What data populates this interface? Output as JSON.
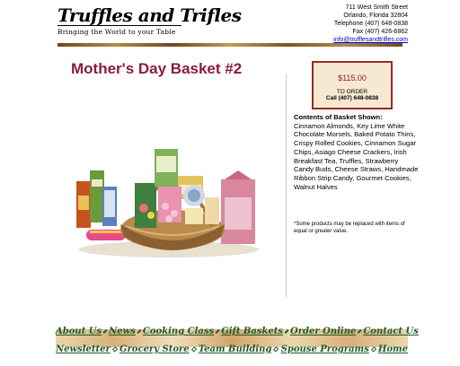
{
  "logo": {
    "script": "Truffles and Trifles",
    "tagline": "Bringing the World to your Table"
  },
  "contact": {
    "street": "711 West Smith Street",
    "city": "Orlando, Florida 32804",
    "telephone": "Telephone (407) 648-0838",
    "fax": "Fax (407) 426-6862",
    "email": "info@trufflesandtrifles.com"
  },
  "product": {
    "title": "Mother's Day Basket #2",
    "price": "$115.00",
    "to_order": "TO ORDER",
    "call": "Call (407) 648-0838",
    "contents_heading": "Contents of Basket Shown:",
    "contents_text": "Cinnamon Almonds, Key Lime White Chocolate Morsels, Baked Potato Thins, Crispy Rolled Cookies, Cinnamon Sugar Chips, Asiago Cheese Crackers, Irish Breakfast Tea, Truffles, Strawberry Candy Buds, Cheese Straws, Handmade Ribbon Strip Candy, Gourmet Cookies, Walnut Halves",
    "note": "*Some products may be replaced with items of equal or greater value."
  },
  "nav": {
    "row1": [
      "About Us",
      "News",
      "Cooking Class",
      "Gift Baskets",
      "Order Online",
      "Contact Us"
    ],
    "row2": [
      "Newsletter",
      "Grocery Store",
      "Team Building",
      "Spouse Programs",
      "Home"
    ]
  },
  "colors": {
    "title": "#8b1c3b",
    "nav_text": "#1f5a2a",
    "price_border": "#9a2a2a",
    "price_bg": "#f7e9d1"
  }
}
